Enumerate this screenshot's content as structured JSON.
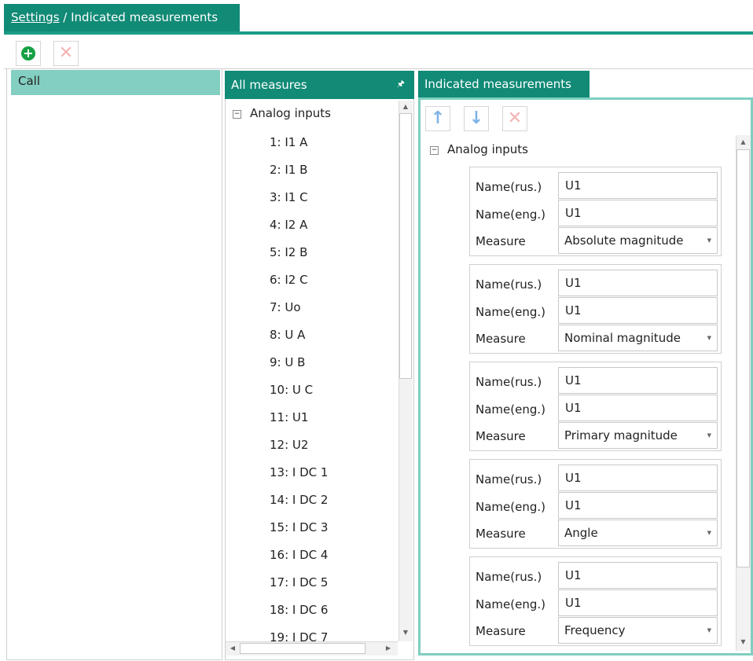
{
  "header": {
    "link": "Settings",
    "separator": " / ",
    "title": "Indicated measurements"
  },
  "left_panel": {
    "items": [
      {
        "label": "Call"
      }
    ]
  },
  "all_measures": {
    "title": "All measures",
    "pin_icon": "pin-icon",
    "group": "Analog inputs",
    "items": [
      "1: I1 A",
      "2: I1 B",
      "3: I1 C",
      "4: I2 A",
      "5: I2 B",
      "6: I2 C",
      "7: Uo",
      "8: U A",
      "9: U B",
      "10: U C",
      "11: U1",
      "12: U2",
      "13: I DC 1",
      "14: I DC 2",
      "15: I DC 3",
      "16: I DC 4",
      "17: I DC 5",
      "18: I DC 6",
      "19: I DC 7"
    ]
  },
  "indicated": {
    "title": "Indicated measurements",
    "group": "Analog inputs",
    "labels": {
      "name_rus": "Name(rus.)",
      "name_eng": "Name(eng.)",
      "measure": "Measure"
    },
    "cards": [
      {
        "name_rus": "U1",
        "name_eng": "U1",
        "measure": "Absolute magnitude"
      },
      {
        "name_rus": "U1",
        "name_eng": "U1",
        "measure": "Nominal magnitude"
      },
      {
        "name_rus": "U1",
        "name_eng": "U1",
        "measure": "Primary magnitude"
      },
      {
        "name_rus": "U1",
        "name_eng": "U1",
        "measure": "Angle"
      },
      {
        "name_rus": "U1",
        "name_eng": "U1",
        "measure": "Frequency"
      }
    ]
  },
  "colors": {
    "accent": "#118a76",
    "selected": "#83cfc1",
    "panel_border": "#7fcfc0",
    "add": "#17a045",
    "delete": "#f3b3b3",
    "arrow": "#7fb3e6"
  }
}
